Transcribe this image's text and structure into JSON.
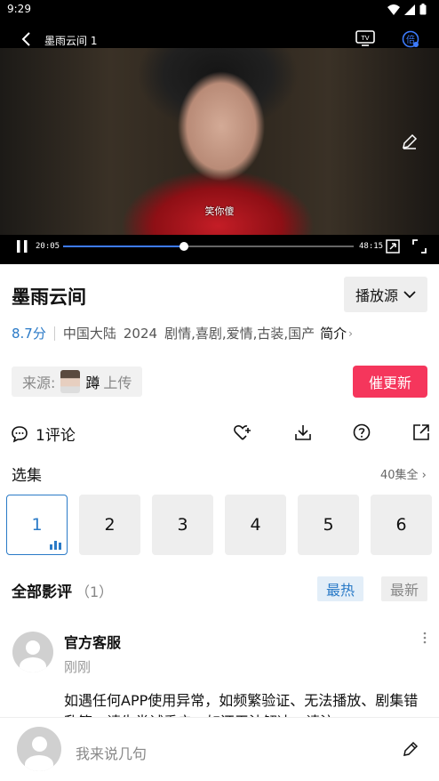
{
  "status_bar": {
    "time": "9:29"
  },
  "player": {
    "title": "墨雨云间 1",
    "subtitle": "笑你傻",
    "current_time": "20:05",
    "total_time": "48:15",
    "progress": 0.416,
    "speed_badge": "倍"
  },
  "drama": {
    "title": "墨雨云间",
    "source_button": "播放源",
    "score": "8.7分",
    "region": "中国大陆",
    "year": "2024",
    "genres": "剧情,喜剧,爱情,古装,国产",
    "intro_label": "简介"
  },
  "uploader": {
    "label": "来源:",
    "name": "蹲",
    "suffix": "上传",
    "urge_button": "催更新"
  },
  "actions": {
    "comment_count": "1评论"
  },
  "episodes": {
    "heading": "选集",
    "total_label": "40集全",
    "items": [
      "1",
      "2",
      "3",
      "4",
      "5",
      "6"
    ]
  },
  "reviews": {
    "heading": "全部影评",
    "count": "（1）",
    "tab_hot": "最热",
    "tab_new": "最新",
    "comment": {
      "author": "官方客服",
      "time": "刚刚",
      "text": "如遇任何APP使用异常，如频繁验证、无法播放、剧集错乱等，请先尝试重启，如还无法解决，请注"
    }
  },
  "comment_bar": {
    "placeholder": "我来说几句"
  },
  "colors": {
    "accent_blue": "#2a7ac7",
    "urge_red": "#f5365c",
    "progress_blue": "#3d7bfd"
  }
}
